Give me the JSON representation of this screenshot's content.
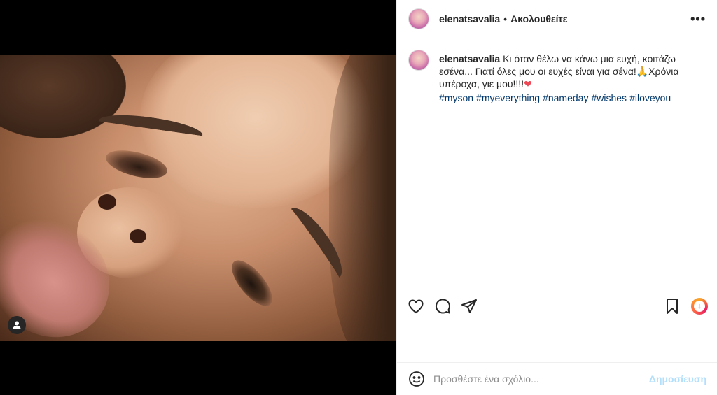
{
  "post": {
    "username": "elenatsavalia",
    "separator": "•",
    "follow_label": "Ακολουθείτε",
    "more_icon": "more-horizontal-icon",
    "more_label": "•••"
  },
  "caption": {
    "username": "elenatsavalia",
    "text": "Κι όταν θέλω να κάνω μια ευχή, κοιτάζω εσένα... Γιατί όλες μου οι ευχές είναι για σένα!🙏Χρόνια υπέροχα, γιε μου!!!!",
    "heart": "❤",
    "hashtags": [
      "#myson",
      "#myeverything",
      "#nameday",
      "#wishes",
      "#iloveyou"
    ]
  },
  "actions": {
    "like_icon": "heart-outline-icon",
    "comment_icon": "comment-bubble-icon",
    "share_icon": "paper-plane-icon",
    "save_icon": "bookmark-icon",
    "extension_icon": "download-extension-icon"
  },
  "comment_box": {
    "placeholder": "Προσθέστε ένα σχόλιο...",
    "post_label": "Δημοσίευση",
    "emoji_icon": "smiley-face-icon"
  },
  "colors": {
    "link": "#00376b",
    "post_button_disabled": "#b2dffc",
    "heart": "#ed4956",
    "border": "#efefef"
  }
}
